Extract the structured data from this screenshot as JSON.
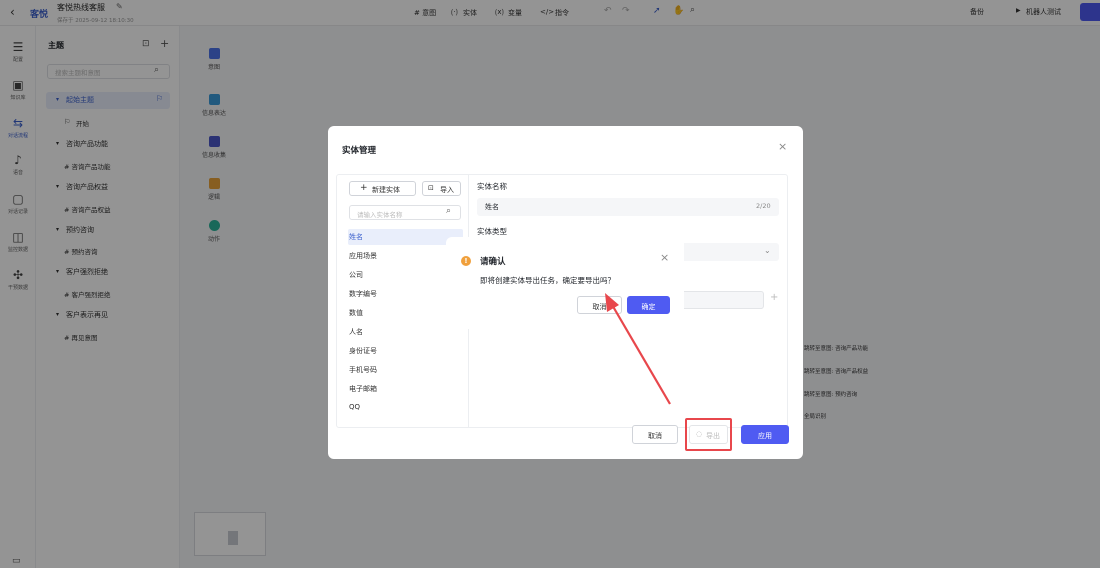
{
  "header": {
    "back_icon": "chevron-left-icon",
    "app_logo": "客悦",
    "title": "客悦热线客服",
    "subtitle": "保存于 2025-09-12 18:10:30",
    "toolbar": {
      "intent": "# 意图",
      "entity": "实体",
      "variable": "变量",
      "command": "指令"
    },
    "backup": "备份",
    "robot_test": "机器人测试"
  },
  "rail": [
    {
      "icon": "settings-icon",
      "label": "配置"
    },
    {
      "icon": "knowledge-icon",
      "label": "知识库"
    },
    {
      "icon": "dialog-flow-icon",
      "label": "对话流程"
    },
    {
      "icon": "voice-icon",
      "label": "语音"
    },
    {
      "icon": "dialog-record-icon",
      "label": "对话记录"
    },
    {
      "icon": "monitor-icon",
      "label": "监控数据"
    },
    {
      "icon": "share-icon",
      "label": "干预数据"
    }
  ],
  "topic_panel": {
    "title": "主题",
    "search_placeholder": "搜索主题和意图",
    "groups": [
      {
        "name": "起始主题",
        "child": "开始"
      },
      {
        "name": "咨询产品功能",
        "child": "# 咨询产品功能"
      },
      {
        "name": "咨询产品权益",
        "child": "# 咨询产品权益"
      },
      {
        "name": "预约咨询",
        "child": "# 预约咨询"
      },
      {
        "name": "客户强烈拒绝",
        "child": "# 客户强烈拒绝"
      },
      {
        "name": "客户表示再见",
        "child": "# 再见意图"
      }
    ]
  },
  "node_tools": [
    {
      "label": "意图",
      "color": "#4a73e8"
    },
    {
      "label": "信息表达",
      "color": "#3a9ad9"
    },
    {
      "label": "信息收集",
      "color": "#4b57c9"
    },
    {
      "label": "逻辑",
      "color": "#e8a23a"
    },
    {
      "label": "动作",
      "color": "#2ab39a"
    }
  ],
  "canvas_labels": [
    "跳转至意图: 咨询产品功能",
    "跳转至意图: 咨询产品权益",
    "跳转至意图: 预约咨询",
    "全局识别"
  ],
  "entity_modal": {
    "title": "实体管理",
    "new_entity": "新建实体",
    "import": "导入",
    "search_placeholder": "请输入实体名称",
    "entities": [
      "姓名",
      "应用场景",
      "公司",
      "数字编号",
      "数值",
      "人名",
      "身份证号",
      "手机号码",
      "电子邮箱",
      "QQ"
    ],
    "field_name_label": "实体名称",
    "field_name_value": "姓名",
    "field_name_count": "2/20",
    "field_type_label": "实体类型",
    "cancel": "取消",
    "export": "导出",
    "apply": "应用"
  },
  "confirm_dialog": {
    "title": "请确认",
    "message": "即将创建实体导出任务，确定要导出吗？",
    "cancel": "取消",
    "ok": "确定"
  },
  "colors": {
    "accent": "#4f5bf2",
    "warning": "#f0a03c",
    "annotation_red": "#e8474c"
  }
}
